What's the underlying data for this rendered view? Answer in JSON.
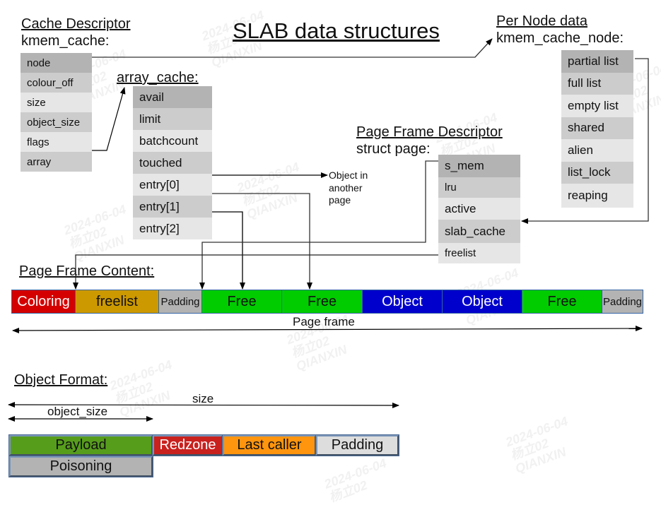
{
  "title": "SLAB data structures",
  "cache_descriptor": {
    "heading": "Cache Descriptor",
    "struct_name": "kmem_cache:",
    "fields": [
      "node",
      "colour_off",
      "size",
      "object_size",
      "flags",
      "array"
    ]
  },
  "array_cache": {
    "heading": "array_cache:",
    "fields": [
      "avail",
      "limit",
      "batchcount",
      "touched",
      "entry[0]",
      "entry[1]",
      "entry[2]"
    ]
  },
  "per_node": {
    "heading": "Per Node data",
    "struct_name": "kmem_cache_node:",
    "fields": [
      "partial list",
      "full list",
      "empty list",
      "shared",
      "alien",
      "list_lock",
      "reaping"
    ]
  },
  "page_descriptor": {
    "heading": "Page Frame Descriptor",
    "struct_name": "struct page:",
    "fields": [
      "s_mem",
      "lru",
      "active",
      "slab_cache",
      "freelist"
    ]
  },
  "annotations": {
    "object_in_another_page": [
      "Object in",
      "another",
      "page"
    ]
  },
  "page_frame_content": {
    "heading": "Page Frame Content:",
    "segments": [
      {
        "label": "Coloring",
        "color": "#d40000",
        "text_color": "#ffffff"
      },
      {
        "label": "freelist",
        "color": "#cc9900",
        "text_color": "#111111"
      },
      {
        "label": "Padding",
        "color": "#b3b3b3",
        "text_color": "#111111"
      },
      {
        "label": "Free",
        "color": "#00cc00",
        "text_color": "#111111"
      },
      {
        "label": "Free",
        "color": "#00cc00",
        "text_color": "#111111"
      },
      {
        "label": "Object",
        "color": "#0000cc",
        "text_color": "#ffffff"
      },
      {
        "label": "Object",
        "color": "#0000cc",
        "text_color": "#ffffff"
      },
      {
        "label": "Free",
        "color": "#00cc00",
        "text_color": "#111111"
      },
      {
        "label": "Padding",
        "color": "#b3b3b3",
        "text_color": "#111111"
      }
    ],
    "span_label": "Page frame"
  },
  "object_format": {
    "heading": "Object Format:",
    "size_label": "size",
    "object_size_label": "object_size",
    "segments": [
      {
        "label": "Payload",
        "color": "#579d1c",
        "text_color": "#111111"
      },
      {
        "label": "Redzone",
        "color": "#c9211e",
        "text_color": "#ffffff"
      },
      {
        "label": "Last caller",
        "color": "#ff950e",
        "text_color": "#111111"
      },
      {
        "label": "Padding",
        "color": "#dddddd",
        "text_color": "#111111"
      }
    ],
    "overlay_segment": {
      "label": "Poisoning",
      "color": "#b3b3b3",
      "text_color": "#111111"
    }
  },
  "watermark": {
    "lines": [
      "2024-06-04",
      "杨立02",
      "QIANXIN"
    ]
  }
}
